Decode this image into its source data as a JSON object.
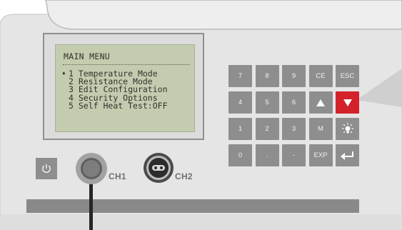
{
  "lcd": {
    "title": "MAIN MENU",
    "cursor_glyph": "➧",
    "menu_items": [
      {
        "number": "1",
        "label": "Temperature Mode",
        "selected": true
      },
      {
        "number": "2",
        "label": "Resistance Mode",
        "selected": false
      },
      {
        "number": "3",
        "label": "Edit Configuration",
        "selected": false
      },
      {
        "number": "4",
        "label": "Security Options",
        "selected": false
      },
      {
        "number": "5",
        "label": "Self Heat Test:OFF",
        "selected": false
      }
    ]
  },
  "keypad": {
    "rows": [
      [
        {
          "label": "7",
          "name": "key-7"
        },
        {
          "label": "8",
          "name": "key-8"
        },
        {
          "label": "9",
          "name": "key-9"
        },
        {
          "label": "CE",
          "name": "key-ce"
        },
        {
          "label": "ESC",
          "name": "key-esc"
        }
      ],
      [
        {
          "label": "4",
          "name": "key-4"
        },
        {
          "label": "5",
          "name": "key-5"
        },
        {
          "label": "6",
          "name": "key-6"
        },
        {
          "label": "",
          "name": "key-up",
          "icon": "arrow-up-icon"
        },
        {
          "label": "",
          "name": "key-down",
          "icon": "arrow-down-icon",
          "active": true
        }
      ],
      [
        {
          "label": "1",
          "name": "key-1"
        },
        {
          "label": "2",
          "name": "key-2"
        },
        {
          "label": "3",
          "name": "key-3"
        },
        {
          "label": "M",
          "name": "key-m"
        },
        {
          "label": "",
          "name": "key-backlight",
          "icon": "backlight-icon"
        }
      ],
      [
        {
          "label": "0",
          "name": "key-0"
        },
        {
          "label": ".",
          "name": "key-decimal"
        },
        {
          "label": "-",
          "name": "key-minus"
        },
        {
          "label": "EXP",
          "name": "key-exp"
        },
        {
          "label": "",
          "name": "key-enter",
          "icon": "enter-icon"
        }
      ]
    ]
  },
  "channels": {
    "ch1": {
      "label": "CH1"
    },
    "ch2": {
      "label": "CH2"
    }
  },
  "colors": {
    "panel": "#e6e6e6",
    "lcd_background": "#c4ccb0",
    "key": "#8e8e8e",
    "key_active": "#d3222a",
    "bar": "#8a8a8a"
  },
  "icons": {
    "power": "power-icon",
    "up": "arrow-up-icon",
    "down": "arrow-down-icon",
    "backlight": "backlight-icon",
    "enter": "enter-icon"
  }
}
